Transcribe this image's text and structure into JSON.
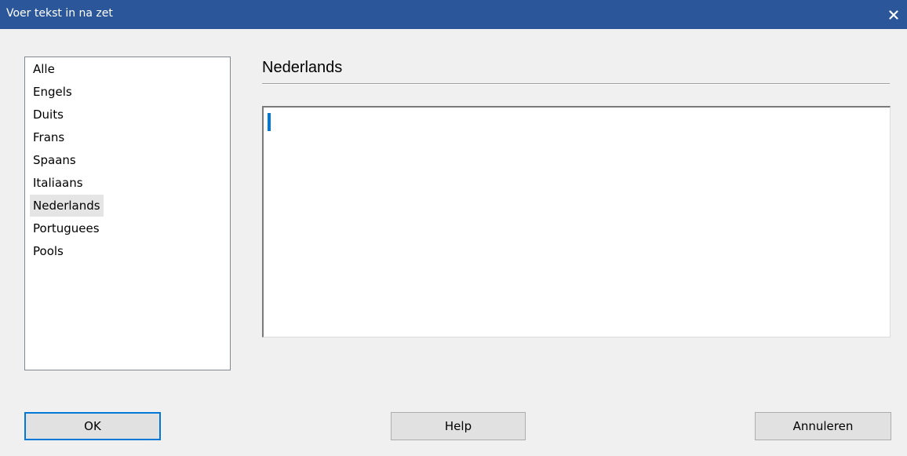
{
  "window": {
    "title": "Voer tekst in na zet",
    "close_icon": "close-icon"
  },
  "languages": {
    "items": [
      {
        "label": "Alle"
      },
      {
        "label": "Engels"
      },
      {
        "label": "Duits"
      },
      {
        "label": "Frans"
      },
      {
        "label": "Spaans"
      },
      {
        "label": "Italiaans"
      },
      {
        "label": "Nederlands"
      },
      {
        "label": "Portuguees"
      },
      {
        "label": "Pools"
      }
    ],
    "selected": "Nederlands"
  },
  "editor": {
    "heading": "Nederlands",
    "value": ""
  },
  "buttons": {
    "ok": "OK",
    "help": "Help",
    "cancel": "Annuleren"
  },
  "colors": {
    "titlebar": "#2b579a",
    "accent": "#0078d7"
  }
}
